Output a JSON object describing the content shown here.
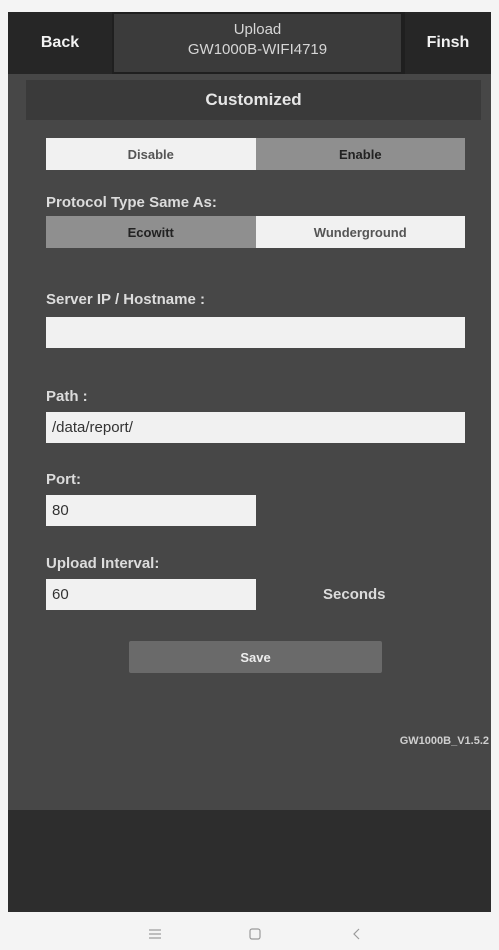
{
  "header": {
    "back_label": "Back",
    "title_line1": "Upload",
    "title_line2": "GW1000B-WIFI4719",
    "finish_label": "Finsh"
  },
  "section_title": "Customized",
  "enable_toggle": {
    "options": [
      "Disable",
      "Enable"
    ],
    "selected": "Enable"
  },
  "protocol": {
    "label": "Protocol Type Same As:",
    "options": [
      "Ecowitt",
      "Wunderground"
    ],
    "selected": "Ecowitt"
  },
  "server": {
    "label": "Server IP / Hostname :",
    "value": ""
  },
  "path": {
    "label": "Path :",
    "value": "/data/report/"
  },
  "port": {
    "label": "Port:",
    "value": "80"
  },
  "interval": {
    "label": "Upload Interval:",
    "value": "60",
    "unit": "Seconds"
  },
  "save_label": "Save",
  "version": "GW1000B_V1.5.2",
  "colors": {
    "header_bg": "#262626",
    "content_bg": "#474747",
    "selected_segment": "#8f8f8f",
    "unselected_segment": "#f1f1f1"
  },
  "nav_icons": [
    "menu-icon",
    "home-icon",
    "back-chevron-icon"
  ]
}
